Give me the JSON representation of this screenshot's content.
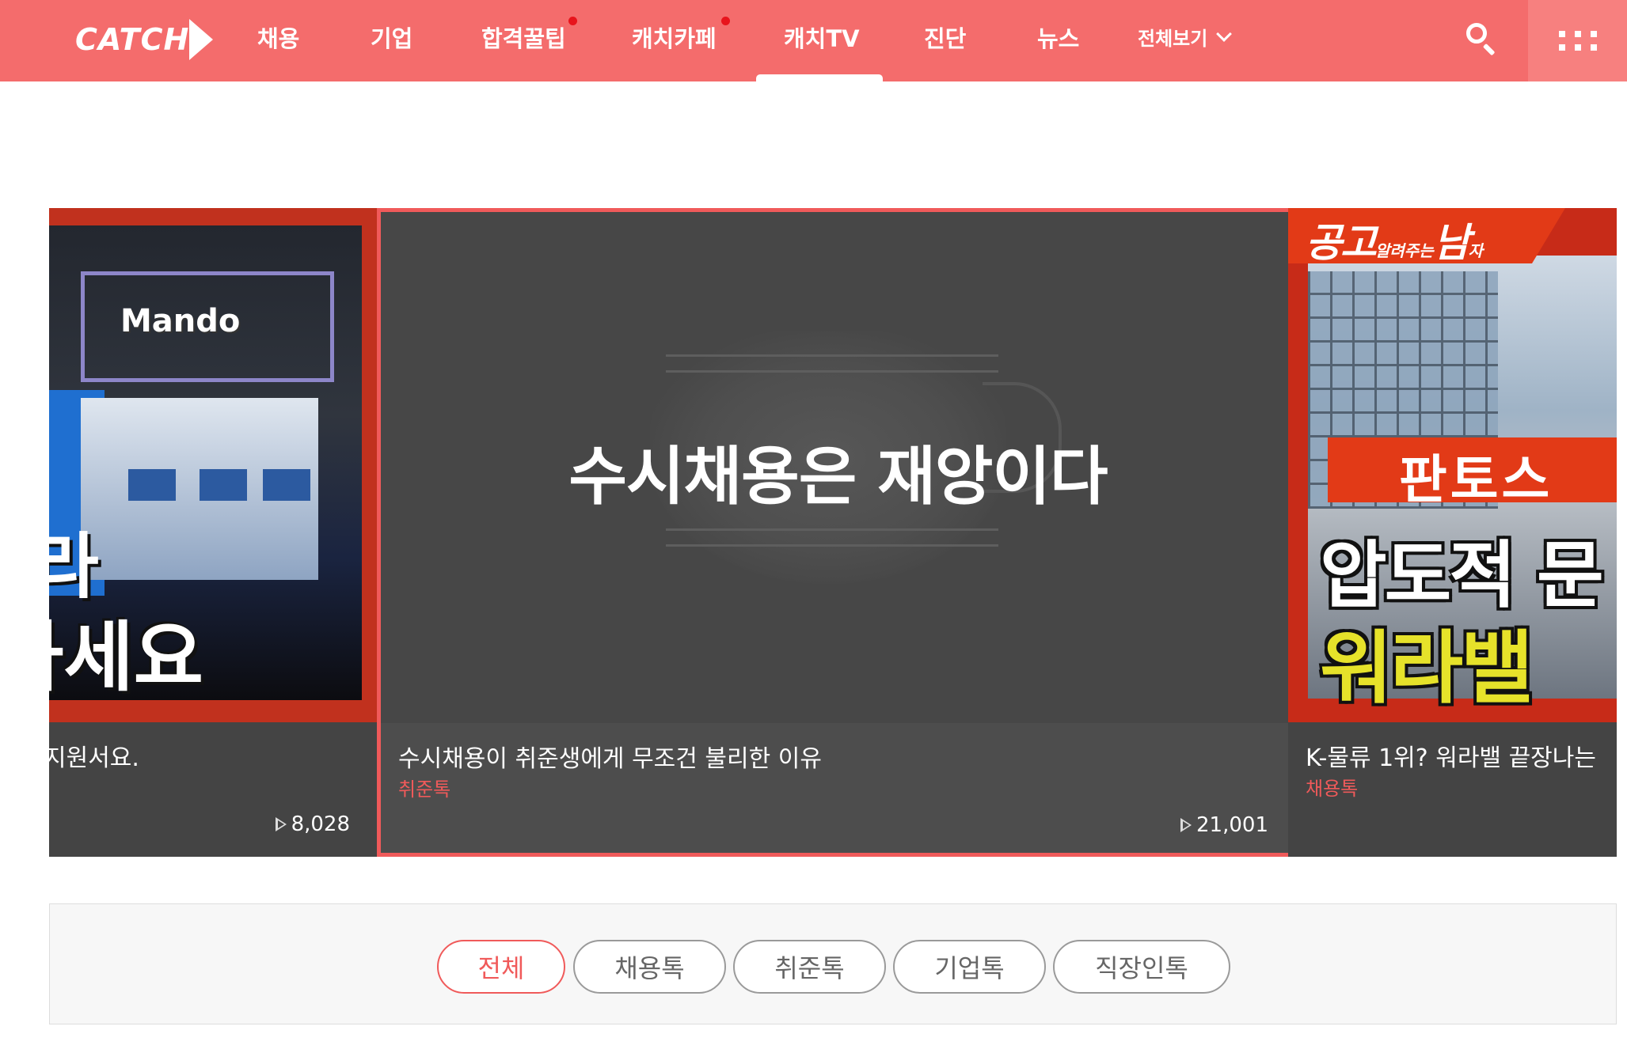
{
  "brand": {
    "logo": "CATCH"
  },
  "nav": {
    "items": [
      {
        "label": "채용",
        "dot": false
      },
      {
        "label": "기업",
        "dot": false
      },
      {
        "label": "합격꿀팁",
        "dot": true
      },
      {
        "label": "캐치카페",
        "dot": true
      },
      {
        "label": "캐치TV",
        "dot": false,
        "active": true
      },
      {
        "label": "진단",
        "dot": false
      },
      {
        "label": "뉴스",
        "dot": false
      }
    ],
    "all_menu": "전체보기",
    "search_icon": "search-icon",
    "apps_icon": "grid-menu-icon",
    "dot_color": "#e8141c",
    "bar_color": "#f46c6c"
  },
  "carousel": {
    "cards": [
      {
        "thumb_text_1": "Mando",
        "thumb_text_2": "라",
        "thumb_text_3": "하세요",
        "title": "지원서요.",
        "category": "",
        "views": "8,028"
      },
      {
        "thumb_text_1": "수시채용은 재앙이다",
        "title": "수시채용이 취준생에게 무조건 불리한 이유",
        "category": "취준톡",
        "views": "21,001"
      },
      {
        "thumb_text_1": "공고",
        "thumb_text_2": "알려주는",
        "thumb_text_3": "남",
        "thumb_text_4": "자",
        "thumb_text_5": "판토스",
        "thumb_text_6": "압도적 문",
        "thumb_text_7": "워라밸",
        "title": "K-물류 1위? 워라밸 끝장나는",
        "category": "채용톡",
        "views": ""
      }
    ],
    "accent_color": "#f05a5a"
  },
  "filters": {
    "chips": [
      "전체",
      "채용톡",
      "취준톡",
      "기업톡",
      "직장인톡"
    ],
    "active_index": 0
  }
}
